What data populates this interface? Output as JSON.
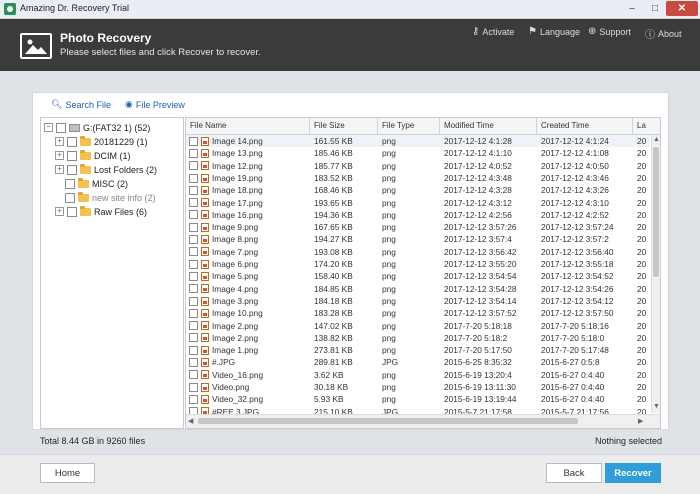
{
  "window": {
    "title": "Amazing Dr. Recovery Trial",
    "min": "–",
    "max": "□",
    "close": "✕"
  },
  "header": {
    "title": "Photo Recovery",
    "subtitle": "Please select files and click Recover to recover.",
    "links": {
      "activate": "Activate",
      "language": "Language",
      "support": "Support",
      "about": "About"
    }
  },
  "tabs": {
    "search": "Search File",
    "preview": "File Preview"
  },
  "tree": {
    "root": "G:(FAT32 1) (52)",
    "items": [
      "20181229 (1)",
      "DCIM (1)",
      "Lost Folders (2)",
      "MISC (2)",
      "new site info (2)",
      "Raw Files (6)"
    ]
  },
  "table": {
    "columns": [
      "File Name",
      "File Size",
      "File Type",
      "Modified Time",
      "Created Time",
      "La"
    ],
    "rows": [
      [
        "Image 14.png",
        "161.55 KB",
        "png",
        "2017-12-12 4:1:28",
        "2017-12-12 4:1:24",
        "20"
      ],
      [
        "Image 13.png",
        "185.46 KB",
        "png",
        "2017-12-12 4:1:10",
        "2017-12-12 4:1:08",
        "20"
      ],
      [
        "Image 12.png",
        "185.77 KB",
        "png",
        "2017-12-12 4:0:52",
        "2017-12-12 4:0:50",
        "20"
      ],
      [
        "Image 19.png",
        "183.52 KB",
        "png",
        "2017-12-12 4:3:48",
        "2017-12-12 4:3:46",
        "20"
      ],
      [
        "Image 18.png",
        "168.46 KB",
        "png",
        "2017-12-12 4:3:28",
        "2017-12-12 4:3:26",
        "20"
      ],
      [
        "Image 17.png",
        "193.65 KB",
        "png",
        "2017-12-12 4:3:12",
        "2017-12-12 4:3:10",
        "20"
      ],
      [
        "Image 16.png",
        "194.36 KB",
        "png",
        "2017-12-12 4:2:56",
        "2017-12-12 4:2:52",
        "20"
      ],
      [
        "Image 9.png",
        "167.65 KB",
        "png",
        "2017-12-12 3:57:26",
        "2017-12-12 3:57:24",
        "20"
      ],
      [
        "Image 8.png",
        "194.27 KB",
        "png",
        "2017-12-12 3:57:4",
        "2017-12-12 3:57:2",
        "20"
      ],
      [
        "Image 7.png",
        "193.08 KB",
        "png",
        "2017-12-12 3:56:42",
        "2017-12-12 3:56:40",
        "20"
      ],
      [
        "Image 6.png",
        "174.20 KB",
        "png",
        "2017-12-12 3:55:20",
        "2017-12-12 3:55:18",
        "20"
      ],
      [
        "Image 5.png",
        "158.40 KB",
        "png",
        "2017-12-12 3:54:54",
        "2017-12-12 3:54:52",
        "20"
      ],
      [
        "Image 4.png",
        "184.85 KB",
        "png",
        "2017-12-12 3:54:28",
        "2017-12-12 3:54:26",
        "20"
      ],
      [
        "Image 3.png",
        "184.18 KB",
        "png",
        "2017-12-12 3:54:14",
        "2017-12-12 3:54:12",
        "20"
      ],
      [
        "Image 10.png",
        "183.28 KB",
        "png",
        "2017-12-12 3:57:52",
        "2017-12-12 3:57:50",
        "20"
      ],
      [
        "Image 2.png",
        "147.02 KB",
        "png",
        "2017-7-20 5:18:18",
        "2017-7-20 5:18:16",
        "20"
      ],
      [
        "Image 2.png",
        "138.82 KB",
        "png",
        "2017-7-20 5:18:2",
        "2017-7-20 5:18:0",
        "20"
      ],
      [
        "Image 1.png",
        "273.81 KB",
        "png",
        "2017-7-20 5:17:50",
        "2017-7-20 5:17:48",
        "20"
      ],
      [
        "#.JPG",
        "289.81 KB",
        "JPG",
        "2015-6-25 8:35:32",
        "2015-6-27 0:5:8",
        "20"
      ],
      [
        "Video_16.png",
        "3.62 KB",
        "png",
        "2015-6-19 13:20:4",
        "2015-6-27 0:4:40",
        "20"
      ],
      [
        "Video.png",
        "30.18 KB",
        "png",
        "2015-6-19 13:11:30",
        "2015-6-27 0:4:40",
        "20"
      ],
      [
        "Video_32.png",
        "5.93 KB",
        "png",
        "2015-6-19 13:19:44",
        "2015-6-27 0:4:40",
        "20"
      ],
      [
        "#REE 3.JPG",
        "215.10 KB",
        "JPG",
        "2015-5-7 21:17:58",
        "2015-5-7 21:17:56",
        "20"
      ]
    ]
  },
  "status": {
    "total": "Total 8.44 GB in 9260 files",
    "selected": "Nothing selected"
  },
  "buttons": {
    "home": "Home",
    "back": "Back",
    "recover": "Recover"
  }
}
